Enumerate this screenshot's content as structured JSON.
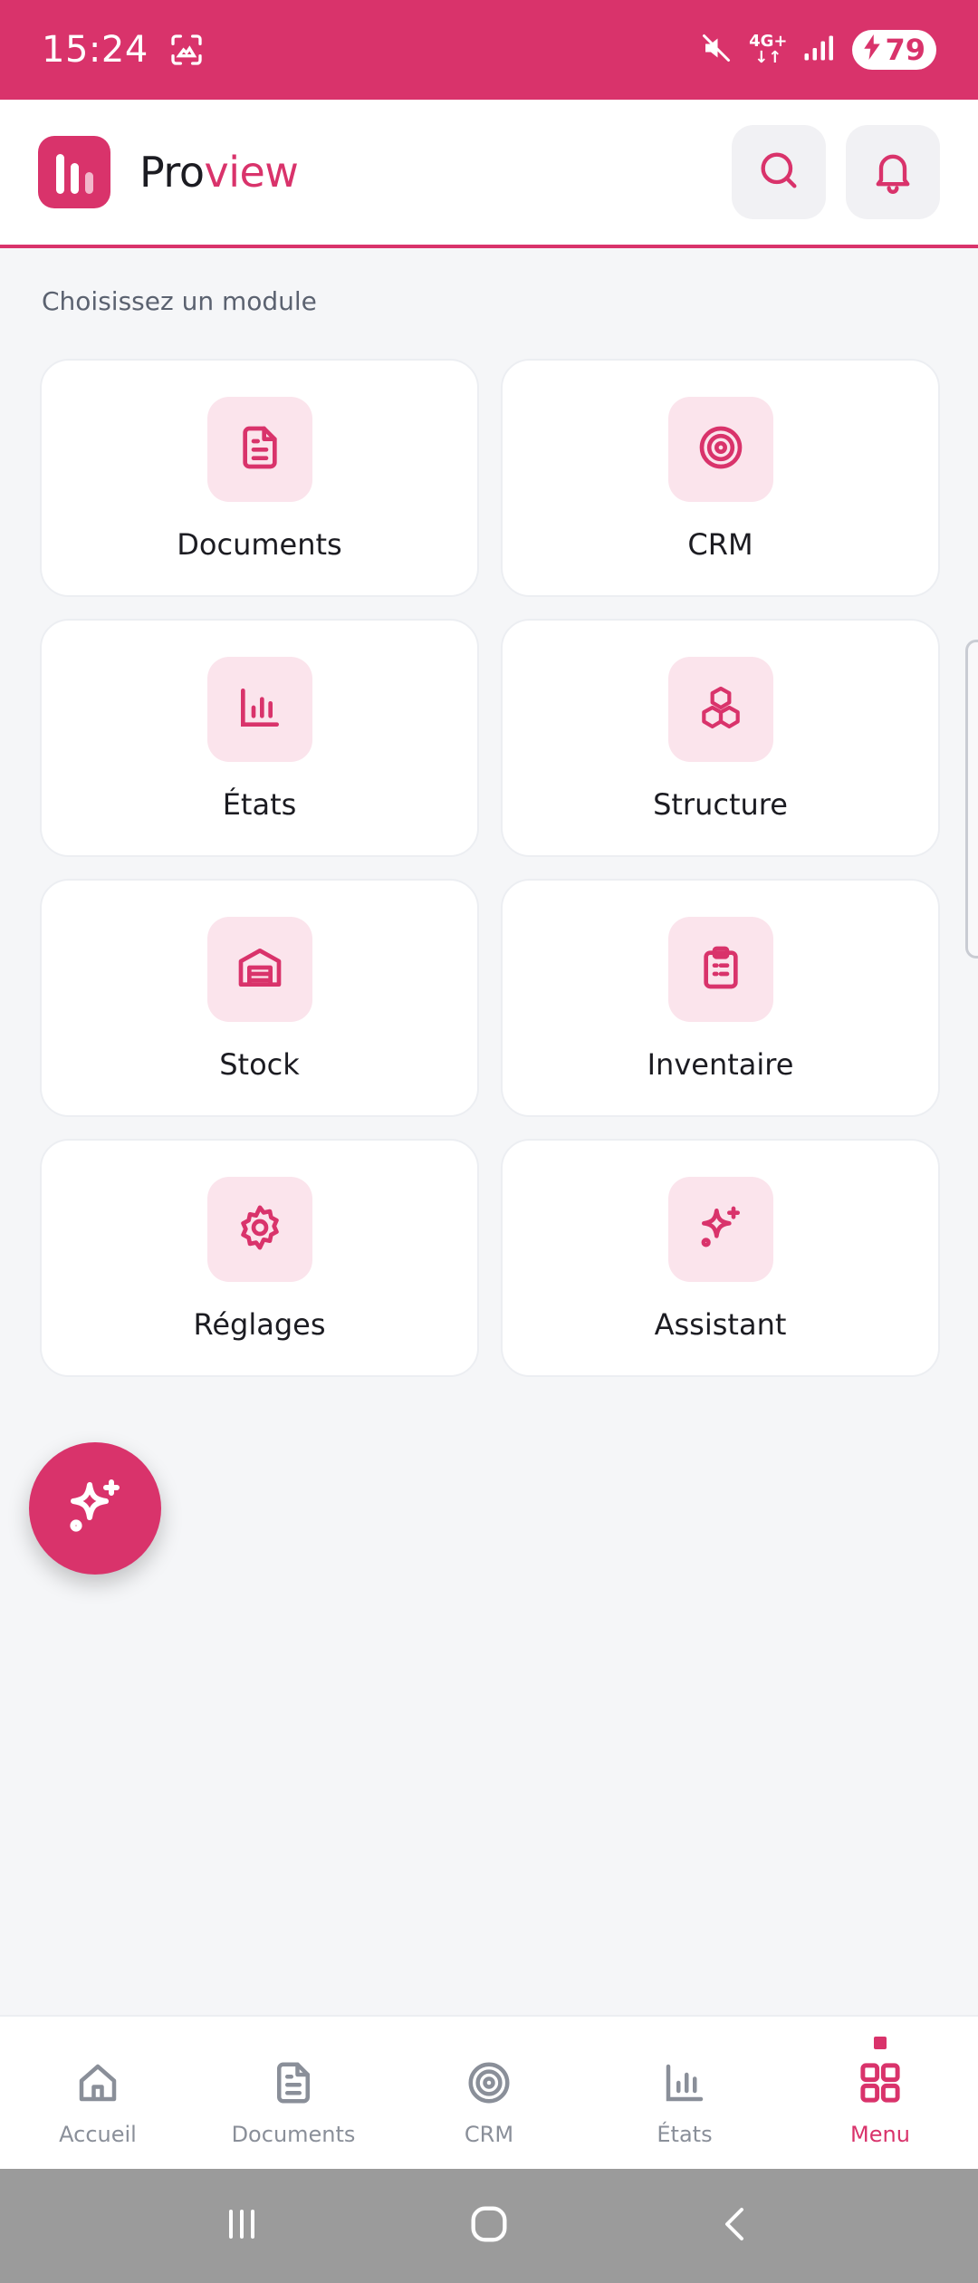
{
  "status_bar": {
    "time": "15:24",
    "network": "4G+",
    "battery": "79",
    "icons": [
      "screenshot-icon",
      "mute-icon",
      "data-arrows-icon",
      "signal-icon",
      "charging-icon"
    ]
  },
  "header": {
    "brand_part1": "Pro",
    "brand_part2": "view",
    "actions": [
      "search-icon",
      "bell-icon"
    ]
  },
  "section_label": "Choisissez un module",
  "modules": [
    {
      "label": "Documents",
      "icon": "document-icon"
    },
    {
      "label": "CRM",
      "icon": "target-icon"
    },
    {
      "label": "États",
      "icon": "bar-chart-icon"
    },
    {
      "label": "Structure",
      "icon": "cubes-icon"
    },
    {
      "label": "Stock",
      "icon": "warehouse-icon"
    },
    {
      "label": "Inventaire",
      "icon": "clipboard-icon"
    },
    {
      "label": "Réglages",
      "icon": "gear-icon"
    },
    {
      "label": "Assistant",
      "icon": "sparkles-icon"
    }
  ],
  "fab": {
    "icon": "sparkles-icon"
  },
  "bottom_nav": [
    {
      "label": "Accueil",
      "icon": "home-icon",
      "active": false
    },
    {
      "label": "Documents",
      "icon": "document-icon",
      "active": false
    },
    {
      "label": "CRM",
      "icon": "target-icon",
      "active": false
    },
    {
      "label": "États",
      "icon": "bar-chart-icon",
      "active": false
    },
    {
      "label": "Menu",
      "icon": "grid-icon",
      "active": true
    }
  ],
  "colors": {
    "accent": "#d9336b",
    "accent_soft": "#fbe4ec",
    "background": "#f5f6f8",
    "inactive": "#8a8f99"
  }
}
